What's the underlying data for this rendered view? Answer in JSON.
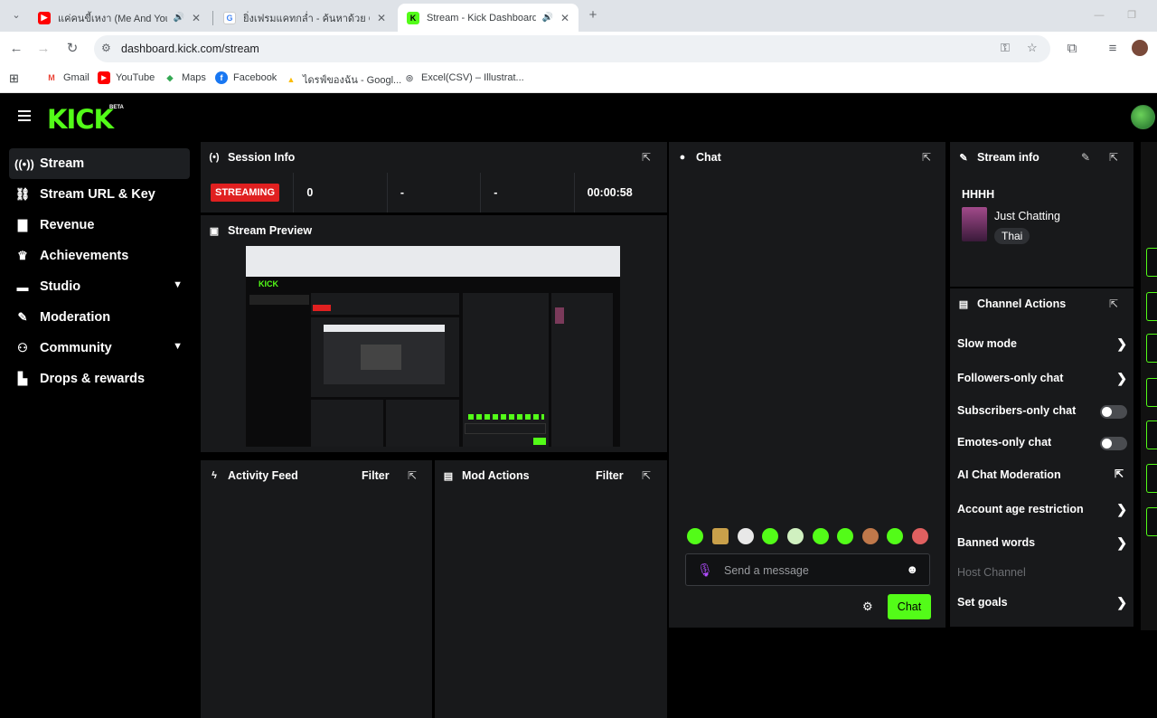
{
  "browser": {
    "tabs": [
      {
        "title": "แค่คนขี้เหงา (Me And You) O",
        "fav_color": "#ff0000",
        "fav_glyph": "▶",
        "audio": true
      },
      {
        "title": "ยิ่งเฟรมแคทกล่ำ - ค้นหาด้วย Google",
        "fav_color": "#4285f4",
        "fav_glyph": "G",
        "audio": false
      },
      {
        "title": "Stream - Kick Dashboard",
        "fav_color": "#53fc18",
        "fav_glyph": "K",
        "audio": true
      }
    ],
    "url": "dashboard.kick.com/stream",
    "bookmarks": [
      {
        "label": "Gmail",
        "fav_color": "#ea4335",
        "fav_glyph": "M"
      },
      {
        "label": "YouTube",
        "fav_color": "#ff0000",
        "fav_glyph": "▶"
      },
      {
        "label": "Maps",
        "fav_color": "#34a853",
        "fav_glyph": "◆"
      },
      {
        "label": "Facebook",
        "fav_color": "#1877f2",
        "fav_glyph": "f"
      },
      {
        "label": "ไดรฟ์ของฉัน - Googl...",
        "fav_color": "#fbbc04",
        "fav_glyph": "▲"
      },
      {
        "label": "Excel(CSV) – Illustrat...",
        "fav_color": "#5f6368",
        "fav_glyph": "◎"
      }
    ]
  },
  "app": {
    "logo": "KICK",
    "logo_badge": "BETA",
    "accent": "#53fc18"
  },
  "sidebar": {
    "items": [
      {
        "label": "Stream",
        "icon": "broadcast-icon",
        "glyph": "⟨•⟩",
        "active": true
      },
      {
        "label": "Stream URL & Key",
        "icon": "link-icon",
        "glyph": "⛓",
        "active": false
      },
      {
        "label": "Revenue",
        "icon": "bar-chart-icon",
        "glyph": "▇",
        "active": false
      },
      {
        "label": "Achievements",
        "icon": "trophy-icon",
        "glyph": "♛",
        "active": false
      },
      {
        "label": "Studio",
        "icon": "film-icon",
        "glyph": "▬",
        "active": false,
        "expandable": true
      },
      {
        "label": "Moderation",
        "icon": "wrench-icon",
        "glyph": "✎",
        "active": false
      },
      {
        "label": "Community",
        "icon": "people-icon",
        "glyph": "⚇",
        "active": false,
        "expandable": true
      },
      {
        "label": "Drops & rewards",
        "icon": "gift-icon",
        "glyph": "▙",
        "active": false
      }
    ]
  },
  "session_info": {
    "title": "Session Info",
    "status": "STREAMING",
    "viewers": "0",
    "stat2": "-",
    "stat3": "-",
    "uptime": "00:00:58"
  },
  "stream_preview": {
    "title": "Stream Preview"
  },
  "activity_feed": {
    "title": "Activity Feed",
    "filter_label": "Filter"
  },
  "mod_actions": {
    "title": "Mod Actions",
    "filter_label": "Filter"
  },
  "chat": {
    "title": "Chat",
    "placeholder": "Send a message",
    "send_label": "Chat",
    "emote_count": 10
  },
  "stream_info": {
    "title": "Stream info",
    "stream_title": "HHHH",
    "category": "Just Chatting",
    "language_tag": "Thai"
  },
  "channel_actions": {
    "title": "Channel Actions",
    "items": [
      {
        "label": "Slow mode",
        "control": "chevron"
      },
      {
        "label": "Followers-only chat",
        "control": "chevron"
      },
      {
        "label": "Subscribers-only chat",
        "control": "toggle"
      },
      {
        "label": "Emotes-only chat",
        "control": "toggle"
      },
      {
        "label": "AI Chat Moderation",
        "control": "external"
      },
      {
        "label": "Account age restriction",
        "control": "chevron"
      },
      {
        "label": "Banned words",
        "control": "chevron"
      },
      {
        "label": "Host Channel",
        "control": "disabled"
      },
      {
        "label": "Set goals",
        "control": "chevron"
      }
    ]
  }
}
